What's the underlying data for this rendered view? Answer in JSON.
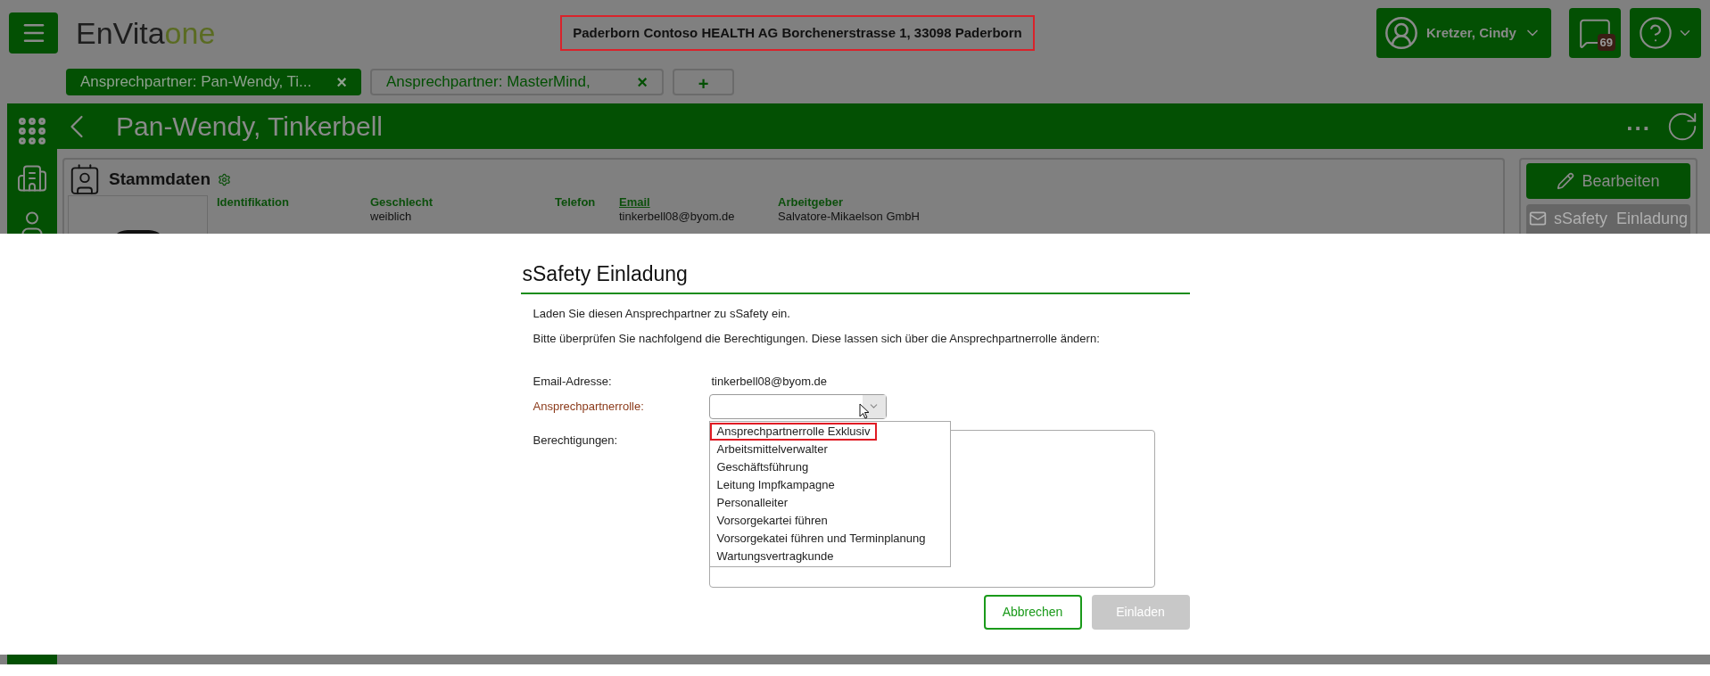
{
  "logo": {
    "primary": "EnVita",
    "secondary": "one"
  },
  "address": "Paderborn Contoso HEALTH AG Borchenerstrasse 1, 33098 Paderborn",
  "user": {
    "name": "Kretzer, Cindy"
  },
  "messages": {
    "badge": "69"
  },
  "tabs": [
    {
      "label": "Ansprechpartner: Pan-Wendy, Ti...",
      "selected": true,
      "close": "×"
    },
    {
      "label": "Ansprechpartner: MasterMind,",
      "selected": false,
      "close": "×"
    }
  ],
  "add_tab": "+",
  "record": {
    "title": "Pan-Wendy, Tinkerbell",
    "more": "..."
  },
  "card": {
    "title": "Stammdaten",
    "fields": [
      {
        "label": "Identifikation",
        "link": false
      },
      {
        "label": "Geschlecht",
        "value": "weiblich",
        "link": false
      },
      {
        "label": "Telefon",
        "link": false
      },
      {
        "label": "Email",
        "value": "tinkerbell08@byom.de",
        "link": true
      },
      {
        "label": "Arbeitgeber",
        "value": "Salvatore-Mikaelson GmbH",
        "link": false
      }
    ]
  },
  "actions": [
    {
      "label": "Bearbeiten",
      "kind": "edit",
      "disabled": false
    },
    {
      "label": "sSafety  Einladung",
      "kind": "mail",
      "disabled": true
    }
  ],
  "dialog": {
    "title": "sSafety Einladung",
    "intro": "Laden Sie diesen Ansprechpartner zu sSafety ein.",
    "hint": "Bitte überprüfen Sie nachfolgend die Berechtigungen. Diese lassen sich über die Ansprechpartnerrolle ändern:",
    "email_label": "Email-Adresse:",
    "email_value": "tinkerbell08@byom.de",
    "role_label": "Ansprechpartnerrolle:",
    "permissions_label": "Berechtigungen:",
    "role_options": [
      {
        "label": "Ansprechpartnerrolle Exklusiv",
        "selected": true
      },
      {
        "label": "Arbeitsmittelverwalter",
        "selected": false
      },
      {
        "label": "Geschäftsführung",
        "selected": false
      },
      {
        "label": "Leitung Impfkampagne",
        "selected": false
      },
      {
        "label": "Personalleiter",
        "selected": false
      },
      {
        "label": "Vorsorgekartei führen",
        "selected": false
      },
      {
        "label": "Vorsorgekatei führen und Terminplanung",
        "selected": false
      },
      {
        "label": "Wartungsvertragkunde",
        "selected": false
      }
    ],
    "cancel": {
      "label": "Abbrechen",
      "disabled": false
    },
    "submit": {
      "label": "Einladen",
      "disabled": true
    }
  }
}
